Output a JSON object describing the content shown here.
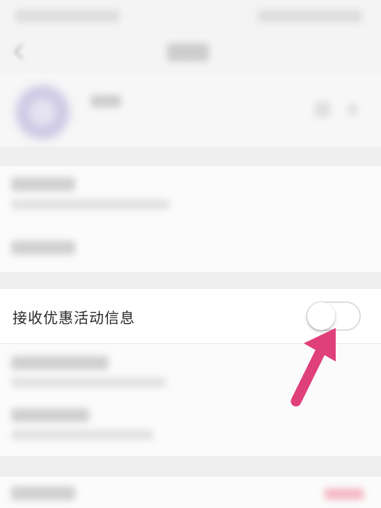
{
  "settings": {
    "promo_toggle_label": "接收优惠活动信息",
    "promo_toggle_state": "off"
  },
  "colors": {
    "annotation_arrow": "#e0407a",
    "toggle_border": "#dcdcdc"
  },
  "icons": {
    "back": "back-arrow-icon",
    "annotation": "annotation-arrow-icon"
  }
}
